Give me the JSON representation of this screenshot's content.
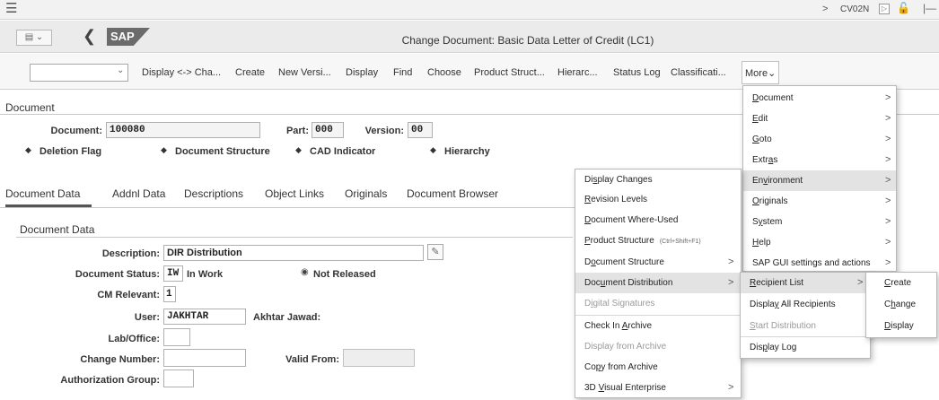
{
  "system_bar": {
    "tx_arrow": ">",
    "tx_code": "CV02N"
  },
  "title_bar": {
    "logo": "SAP",
    "title": "Change Document: Basic Data Letter of Credit (LC1)"
  },
  "toolbar": {
    "buttons": [
      "Display <-> Cha...",
      "Create",
      "New Versi...",
      "Display",
      "Find",
      "Choose",
      "Product Struct...",
      "Hierarc...",
      "Status Log",
      "Classificati..."
    ],
    "more": "More"
  },
  "header": {
    "section_title": "Document",
    "document_label": "Document:",
    "document_value": "100080",
    "part_label": "Part:",
    "part_value": "000",
    "version_label": "Version:",
    "version_value": "00",
    "flags": [
      "Deletion Flag",
      "Document Structure",
      "CAD Indicator",
      "Hierarchy"
    ]
  },
  "tabs": [
    "Document Data",
    "Addnl Data",
    "Descriptions",
    "Object Links",
    "Originals",
    "Document Browser"
  ],
  "document_data": {
    "section_title": "Document Data",
    "description_label": "Description:",
    "description_value": "DIR Distribution",
    "status_label": "Document Status:",
    "status_code": "IW",
    "status_text": "In Work",
    "not_released": "Not Released",
    "cm_label": "CM Relevant:",
    "cm_value": "1",
    "user_label": "User:",
    "user_value": "JAKHTAR",
    "user_name": "Akhtar Jawad:",
    "lab_label": "Lab/Office:",
    "change_label": "Change Number:",
    "valid_label": "Valid From:",
    "auth_label": "Authorization Group:"
  },
  "more_menu": {
    "items": [
      "Document",
      "Edit",
      "Goto",
      "Extras",
      "Environment",
      "Originals",
      "System",
      "Help",
      "SAP GUI settings and actions"
    ]
  },
  "env_menu": {
    "items": [
      "Display Changes",
      "Revision Levels",
      "Document Where-Used",
      "Product Structure",
      "Document Structure",
      "Document Distribution",
      "Digital Signatures",
      "Check In Archive",
      "Display from Archive",
      "Copy from Archive",
      "3D Visual Enterprise"
    ],
    "shortcut": "(Ctrl+Shift+F1)"
  },
  "dist_menu": {
    "items": [
      "Recipient List",
      "Display All Recipients",
      "Start Distribution",
      "Display Log"
    ]
  },
  "recip_menu": {
    "items": [
      "Create",
      "Change",
      "Display"
    ]
  },
  "arrow_glyph": ">"
}
